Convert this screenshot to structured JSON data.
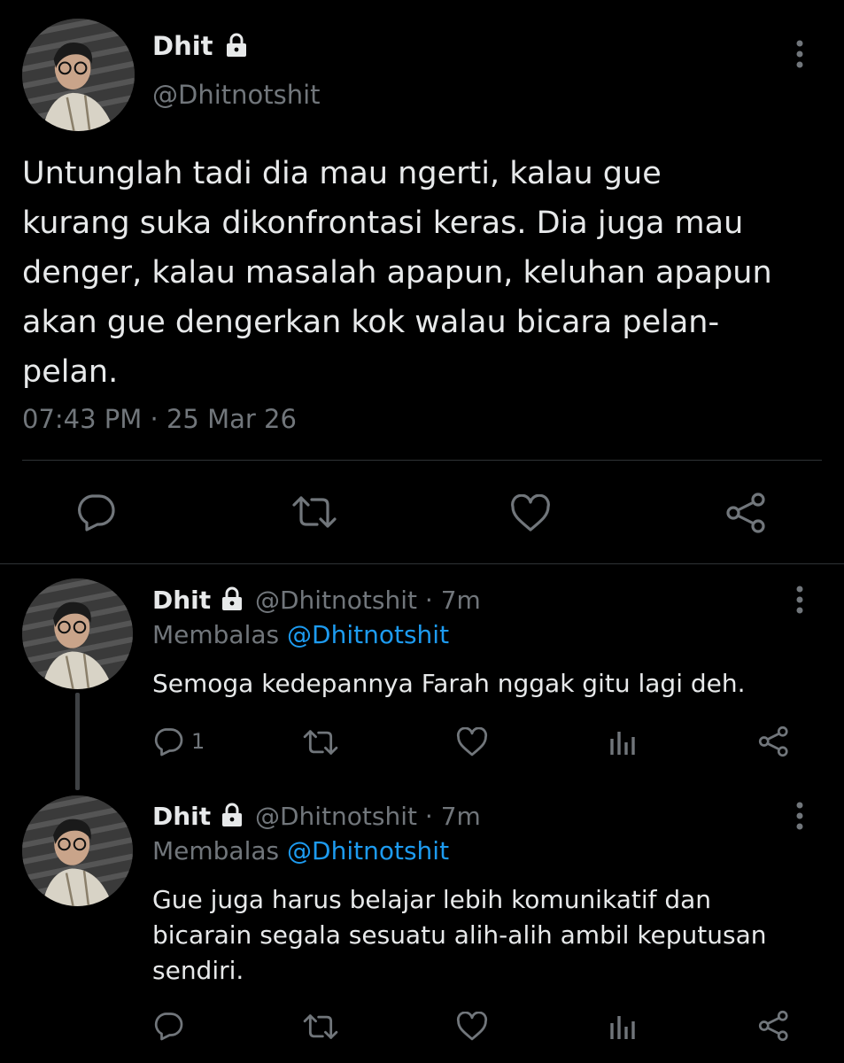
{
  "main_tweet": {
    "display_name": "Dhit",
    "handle": "@Dhitnotshit",
    "text_lines": [
      "Untunglah tadi dia mau ngerti, kalau gue",
      "kurang suka dikonfrontasi keras. Dia juga mau",
      "denger, kalau masalah apapun, keluhan apapun",
      "akan gue dengerkan kok walau bicara pelan-",
      "pelan."
    ],
    "timestamp": "07:43 PM · 25 Mar 26",
    "lock_icon": "lock-icon",
    "actions": [
      "reply-icon",
      "retweet-icon",
      "like-icon",
      "share-icon"
    ]
  },
  "replies": [
    {
      "display_name": "Dhit",
      "handle": "@Dhitnotshit",
      "time": "· 7m",
      "replying_prefix": "Membalas",
      "replying_to": "@Dhitnotshit",
      "text_lines": [
        "Semoga kedepannya Farah nggak gitu lagi deh."
      ],
      "reply_count": "1"
    },
    {
      "display_name": "Dhit",
      "handle": "@Dhitnotshit",
      "time": "· 7m",
      "replying_prefix": "Membalas",
      "replying_to": "@Dhitnotshit",
      "text_lines": [
        "Gue juga harus belajar lebih komunikatif dan",
        "bicarain segala sesuatu alih-alih ambil keputusan",
        "sendiri."
      ],
      "reply_count": ""
    }
  ],
  "colors": {
    "background": "#000000",
    "text": "#e7e9ea",
    "muted": "#71767b",
    "link": "#1d9bf0",
    "divider": "#2f3336"
  }
}
